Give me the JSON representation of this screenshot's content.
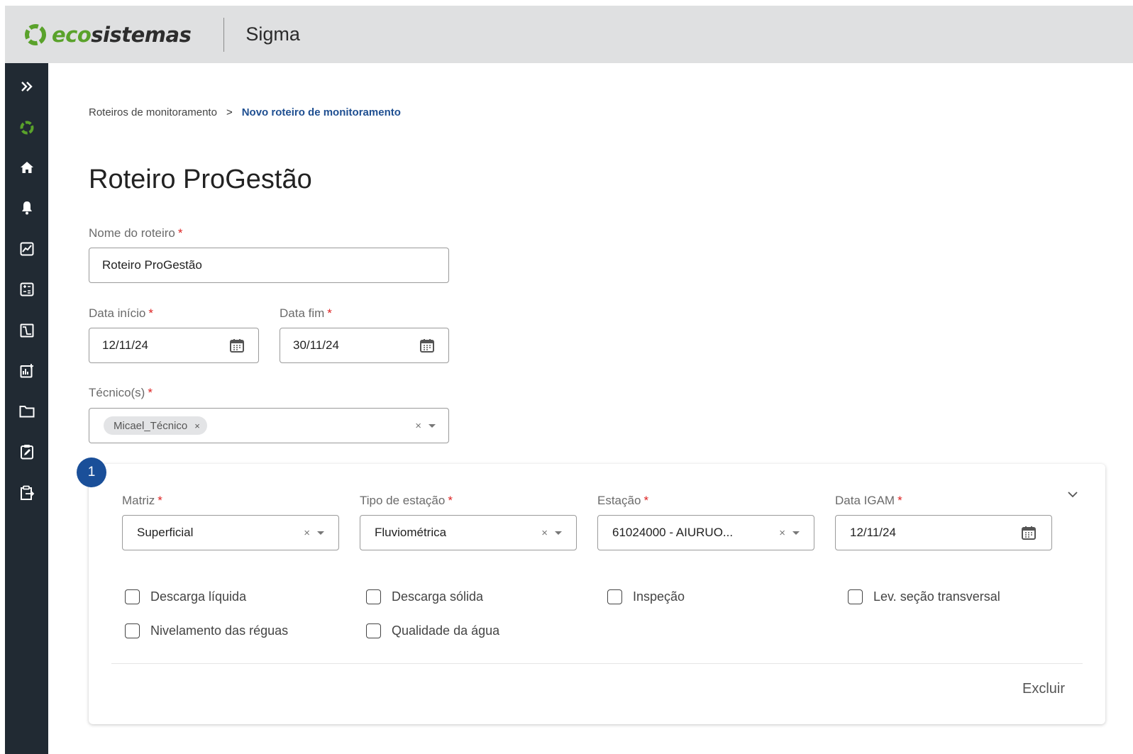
{
  "header": {
    "brand_eco": "eco",
    "brand_sistemas": "sistemas",
    "app_title": "Sigma"
  },
  "sidebar": {
    "items": [
      {
        "icon": "double-chevron-right-icon"
      },
      {
        "icon": "ecosistemas-logo-icon"
      },
      {
        "icon": "home-icon"
      },
      {
        "icon": "bell-icon"
      },
      {
        "icon": "chart-line-icon"
      },
      {
        "icon": "calculator-icon"
      },
      {
        "icon": "waveform-icon"
      },
      {
        "icon": "report-chart-icon"
      },
      {
        "icon": "folder-icon"
      },
      {
        "icon": "clipboard-edit-icon"
      },
      {
        "icon": "clipboard-transfer-icon"
      }
    ]
  },
  "breadcrumb": {
    "parent": "Roteiros de monitoramento",
    "separator": ">",
    "current": "Novo roteiro de monitoramento"
  },
  "page_title": "Roteiro ProGestão",
  "form": {
    "required_mark": "*",
    "nome": {
      "label": "Nome do roteiro",
      "value": "Roteiro ProGestão"
    },
    "data_inicio": {
      "label": "Data início",
      "value": "12/11/24"
    },
    "data_fim": {
      "label": "Data fim",
      "value": "30/11/24"
    },
    "tecnicos": {
      "label": "Técnico(s)",
      "chips": [
        "Micael_Técnico"
      ],
      "chip_remove": "×",
      "clear": "×"
    }
  },
  "card": {
    "step_number": "1",
    "matriz": {
      "label": "Matriz",
      "value": "Superficial",
      "clear": "×"
    },
    "tipo_estacao": {
      "label": "Tipo de estação",
      "value": "Fluviométrica",
      "clear": "×"
    },
    "estacao": {
      "label": "Estação",
      "value": "61024000 - AIURUO...",
      "clear": "×"
    },
    "data_igam": {
      "label": "Data IGAM",
      "value": "12/11/24"
    },
    "checkboxes": [
      {
        "label": "Descarga líquida",
        "checked": false
      },
      {
        "label": "Descarga sólida",
        "checked": false
      },
      {
        "label": "Inspeção",
        "checked": false
      },
      {
        "label": "Lev. seção transversal",
        "checked": false
      },
      {
        "label": "Nivelamento das réguas",
        "checked": false
      },
      {
        "label": "Qualidade da água",
        "checked": false
      }
    ],
    "delete_label": "Excluir"
  },
  "colors": {
    "sidebar_bg": "#212a33",
    "header_bg": "#dfe0e1",
    "accent": "#1a4f99",
    "brand_green": "#5aa22b",
    "required": "#dd2222"
  }
}
